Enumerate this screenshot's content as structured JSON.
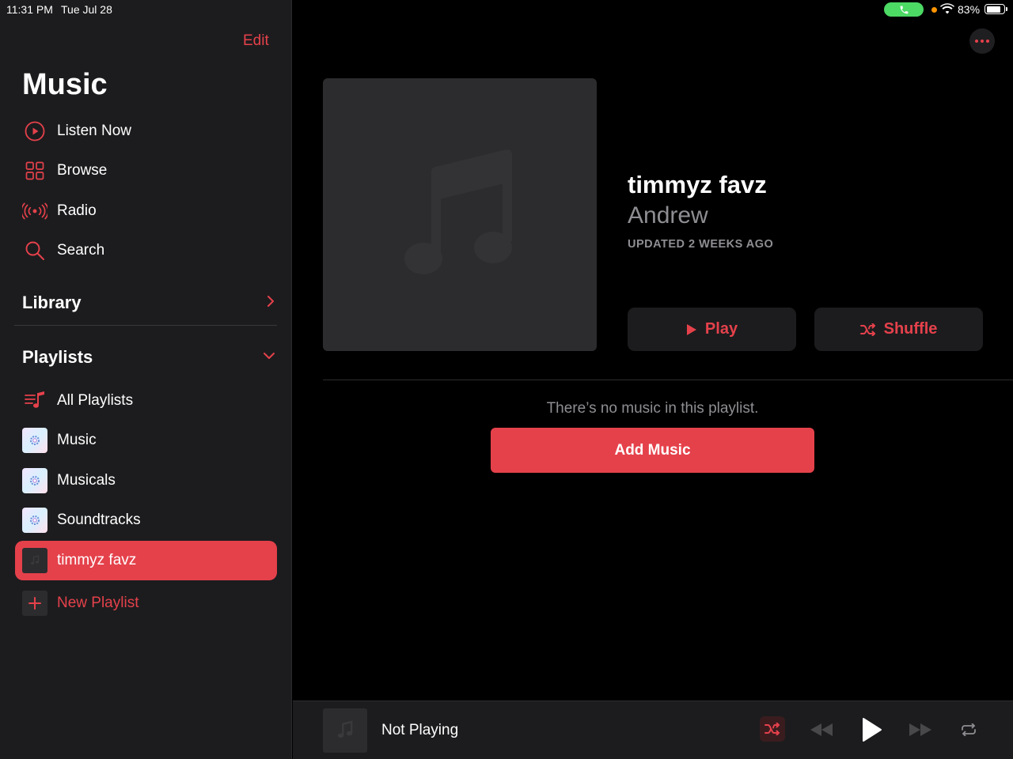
{
  "status_bar": {
    "time": "11:31 PM",
    "date": "Tue Jul 28",
    "battery_percent": "83%",
    "battery_level": 0.83
  },
  "sidebar": {
    "edit_label": "Edit",
    "title": "Music",
    "nav_items": [
      {
        "label": "Listen Now",
        "icon": "play-circle-icon"
      },
      {
        "label": "Browse",
        "icon": "grid-icon"
      },
      {
        "label": "Radio",
        "icon": "radio-waves-icon"
      },
      {
        "label": "Search",
        "icon": "search-icon"
      }
    ],
    "library_label": "Library",
    "playlists_label": "Playlists",
    "playlists": [
      {
        "label": "All Playlists",
        "icon": "playlist-icon"
      },
      {
        "label": "Music",
        "icon": "gear-icon"
      },
      {
        "label": "Musicals",
        "icon": "gear-icon"
      },
      {
        "label": "Soundtracks",
        "icon": "gear-icon"
      },
      {
        "label": "timmyz favz",
        "icon": "music-note-icon",
        "selected": true
      }
    ],
    "new_playlist_label": "New Playlist"
  },
  "playlist": {
    "title": "timmyz favz",
    "author": "Andrew",
    "updated": "UPDATED 2 WEEKS AGO",
    "play_label": "Play",
    "shuffle_label": "Shuffle",
    "empty_message": "There’s no music in this playlist.",
    "add_music_label": "Add Music"
  },
  "player": {
    "now_playing": "Not Playing"
  },
  "colors": {
    "accent": "#e5414b",
    "sidebar_bg": "#1c1c1e",
    "secondary_text": "#8e8e93",
    "call_pill": "#4cd964"
  }
}
